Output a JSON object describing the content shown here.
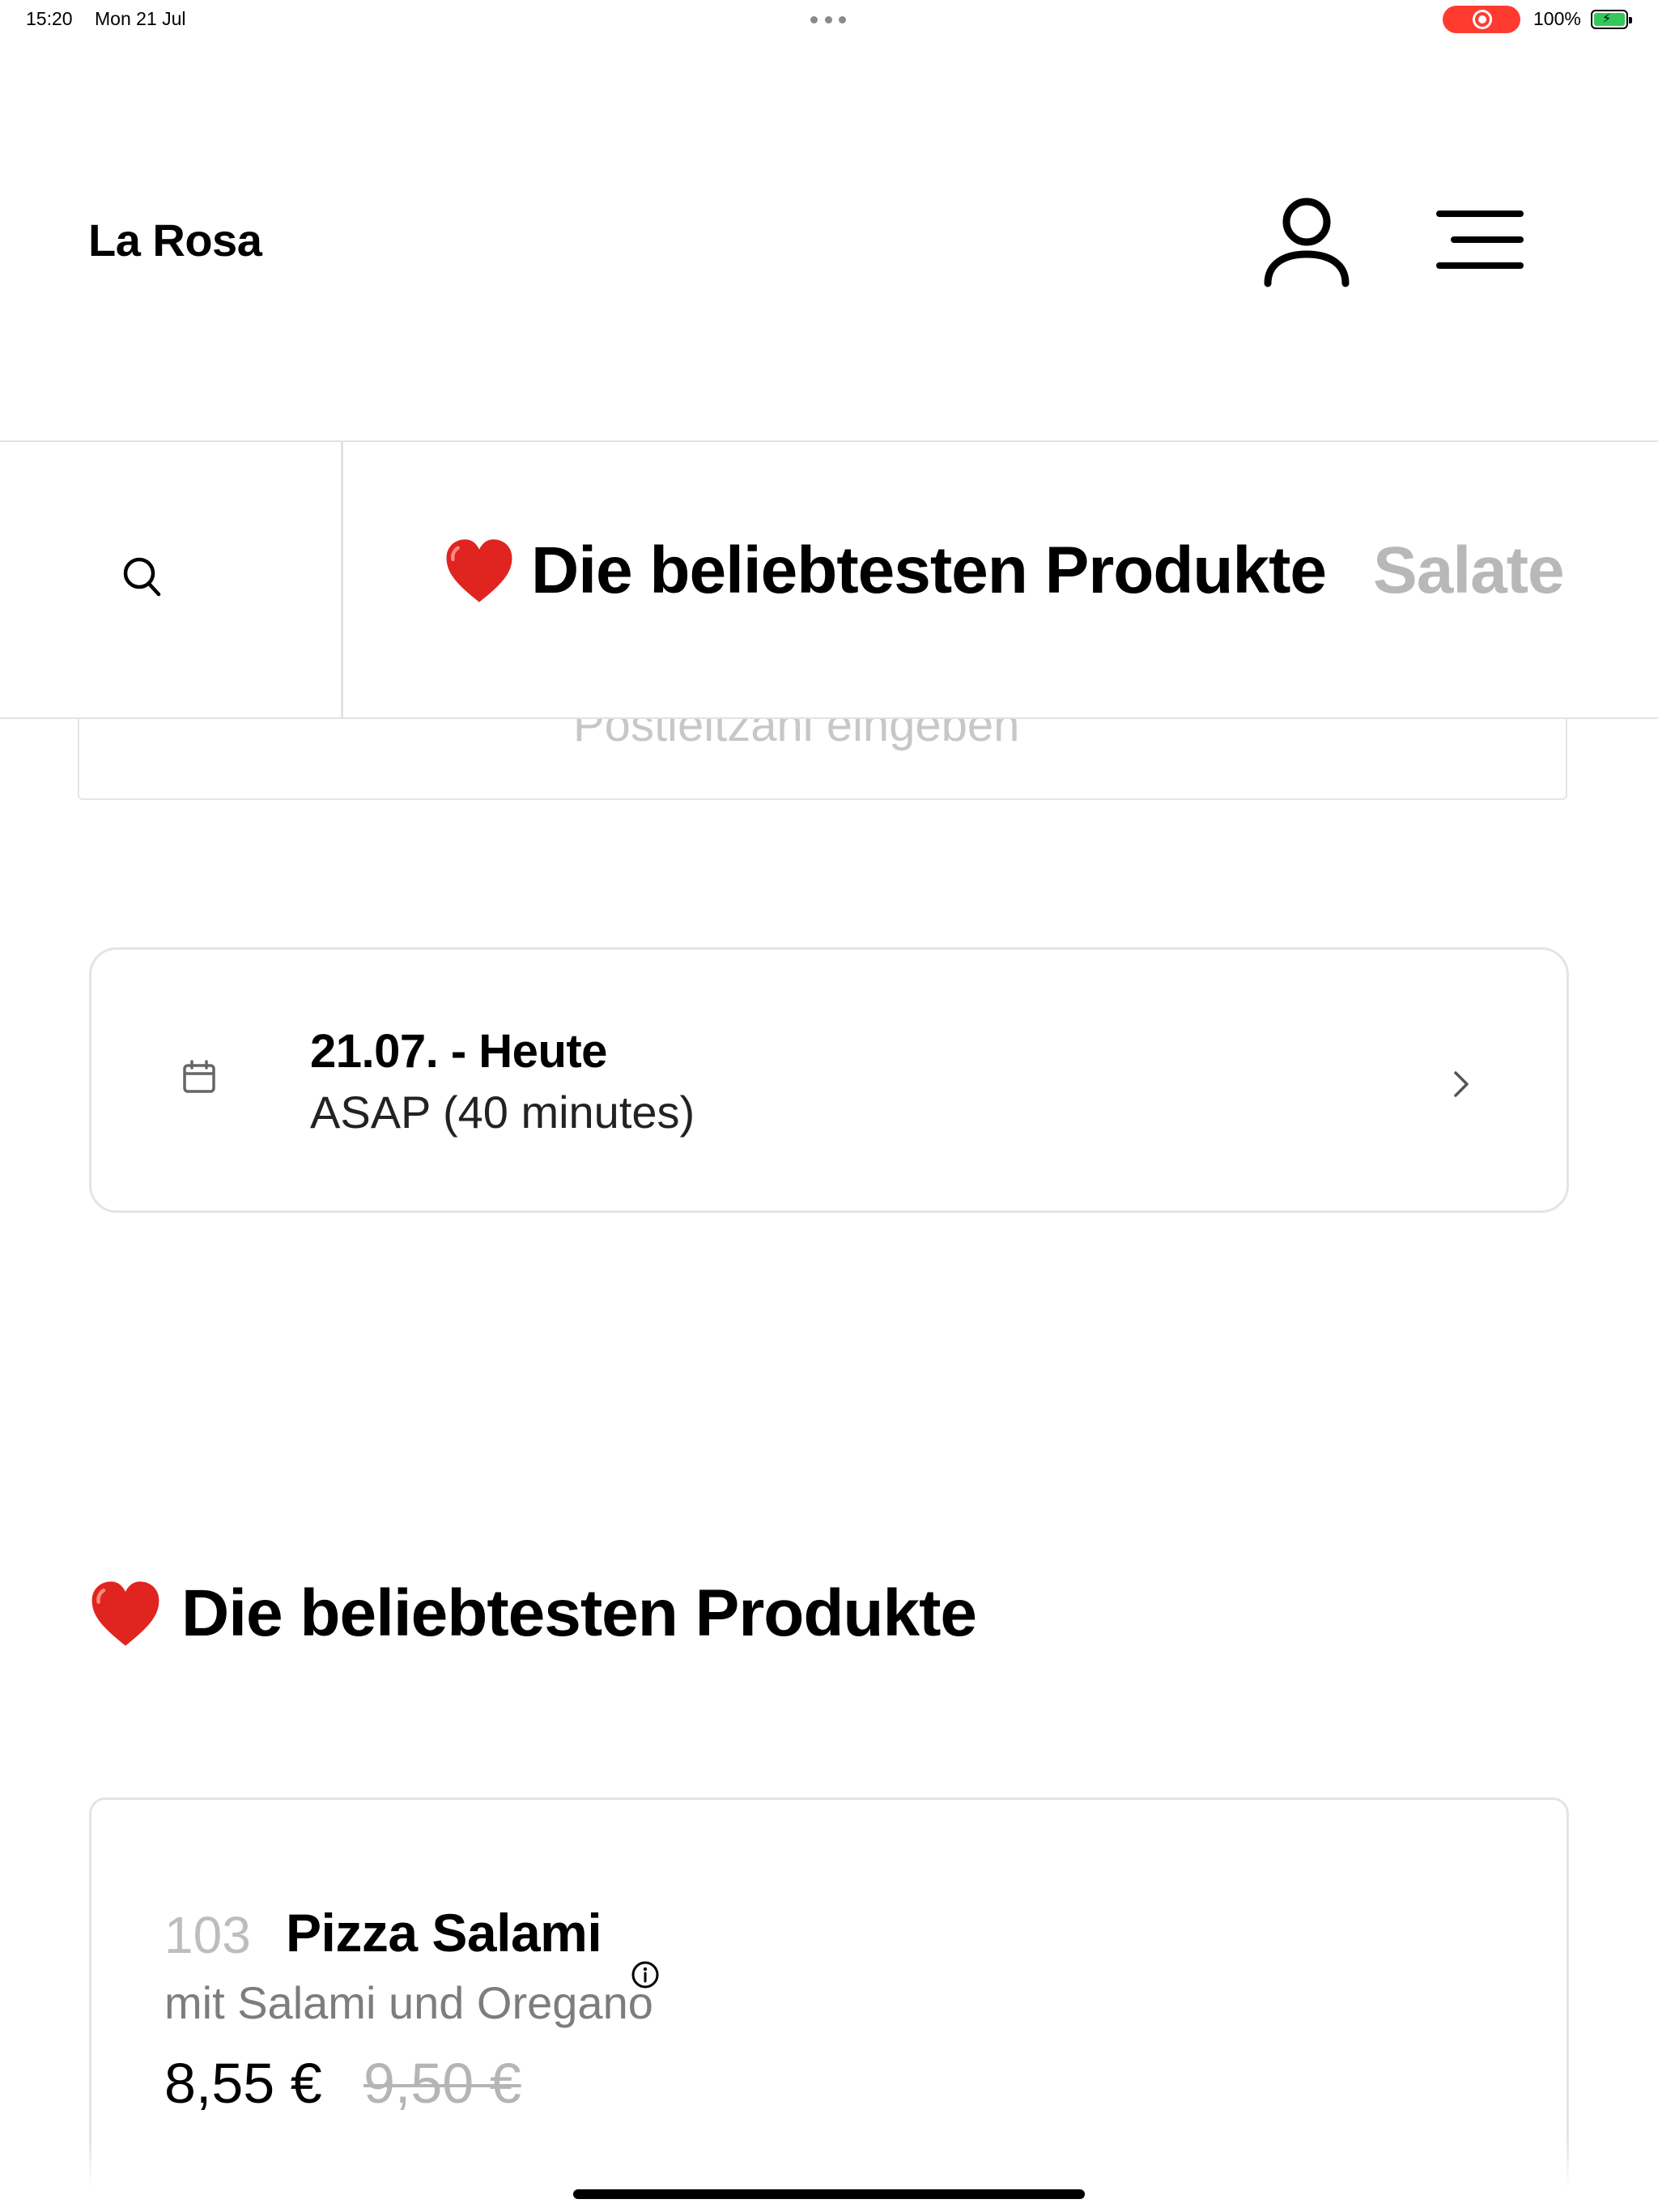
{
  "status_bar": {
    "time": "15:20",
    "date": "Mon 21 Jul",
    "battery": "100%",
    "recording_color": "#ff3b30",
    "battery_color": "#34c759"
  },
  "header": {
    "brand": "La Rosa",
    "account_icon": "user-icon",
    "menu_icon": "hamburger-menu-icon"
  },
  "category_bar": {
    "search_icon": "search-icon",
    "active_tab": "Die beliebtesten Produkte",
    "active_tab_emoji": "heart-icon",
    "next_tab": "Salate"
  },
  "postcode": {
    "placeholder": "Postleitzahl eingeben"
  },
  "delivery_time": {
    "date": "21.07. - Heute",
    "time": "ASAP (40 minutes)",
    "icon": "calendar-icon"
  },
  "section": {
    "title": "Die beliebtesten Produkte"
  },
  "products": [
    {
      "number": "103",
      "name": "Pizza Salami",
      "description": "mit Salami und Oregano",
      "price": "8,55 €",
      "old_price": "9,50 €"
    }
  ]
}
